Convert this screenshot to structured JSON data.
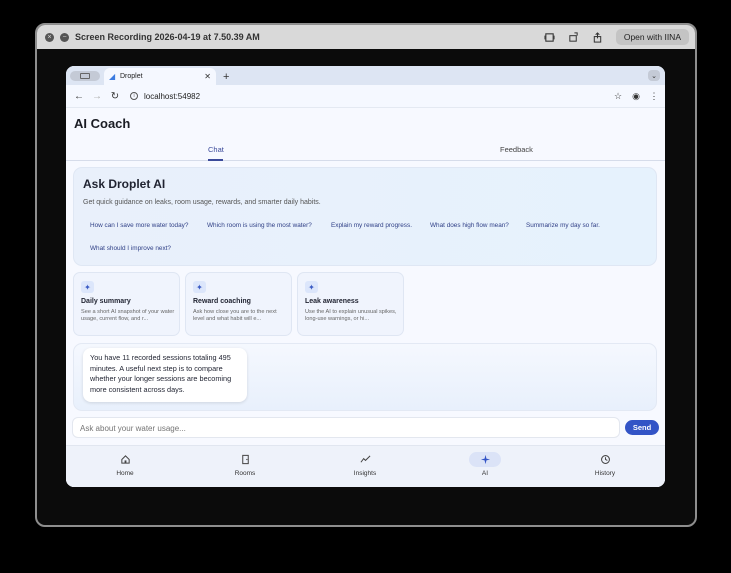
{
  "player": {
    "title": "Screen Recording 2026-04-19 at 7.50.39 AM",
    "open_button": "Open with IINA"
  },
  "browser": {
    "tab_title": "Droplet",
    "new_tab": "+",
    "url": "localhost:54982"
  },
  "app": {
    "title": "AI Coach",
    "tabs": [
      {
        "label": "Chat",
        "active": true
      },
      {
        "label": "Feedback",
        "active": false
      }
    ],
    "hero": {
      "title": "Ask Droplet AI",
      "subtitle": "Get quick guidance on leaks, room usage, rewards, and smarter daily habits.",
      "chips": [
        "How can I save more water today?",
        "Which room is using the most water?",
        "Explain my reward progress.",
        "What does high flow mean?",
        "Summarize my day so far.",
        "What should I improve next?"
      ]
    },
    "cards": [
      {
        "title": "Daily summary",
        "desc": "See a short AI snapshot of your water usage, current flow, and r..."
      },
      {
        "title": "Reward coaching",
        "desc": "Ask how close you are to the next level and what habit will e..."
      },
      {
        "title": "Leak awareness",
        "desc": "Use the AI to explain unusual spikes, long-use warnings, or hi..."
      }
    ],
    "message": "You have 11 recorded sessions totaling 495 minutes. A useful next step is to compare whether your longer sessions are becoming more consistent across days.",
    "composer_placeholder": "Ask about your water usage...",
    "send_label": "Send",
    "nav": [
      {
        "label": "Home",
        "icon": "home-icon",
        "active": false
      },
      {
        "label": "Rooms",
        "icon": "door-icon",
        "active": false
      },
      {
        "label": "Insights",
        "icon": "trend-icon",
        "active": false
      },
      {
        "label": "AI",
        "icon": "sparkle-icon",
        "active": true
      },
      {
        "label": "History",
        "icon": "history-icon",
        "active": false
      }
    ]
  },
  "colors": {
    "accent": "#3354c6",
    "tab_active": "#3b4a9a",
    "chip_text": "#2f3f86"
  }
}
